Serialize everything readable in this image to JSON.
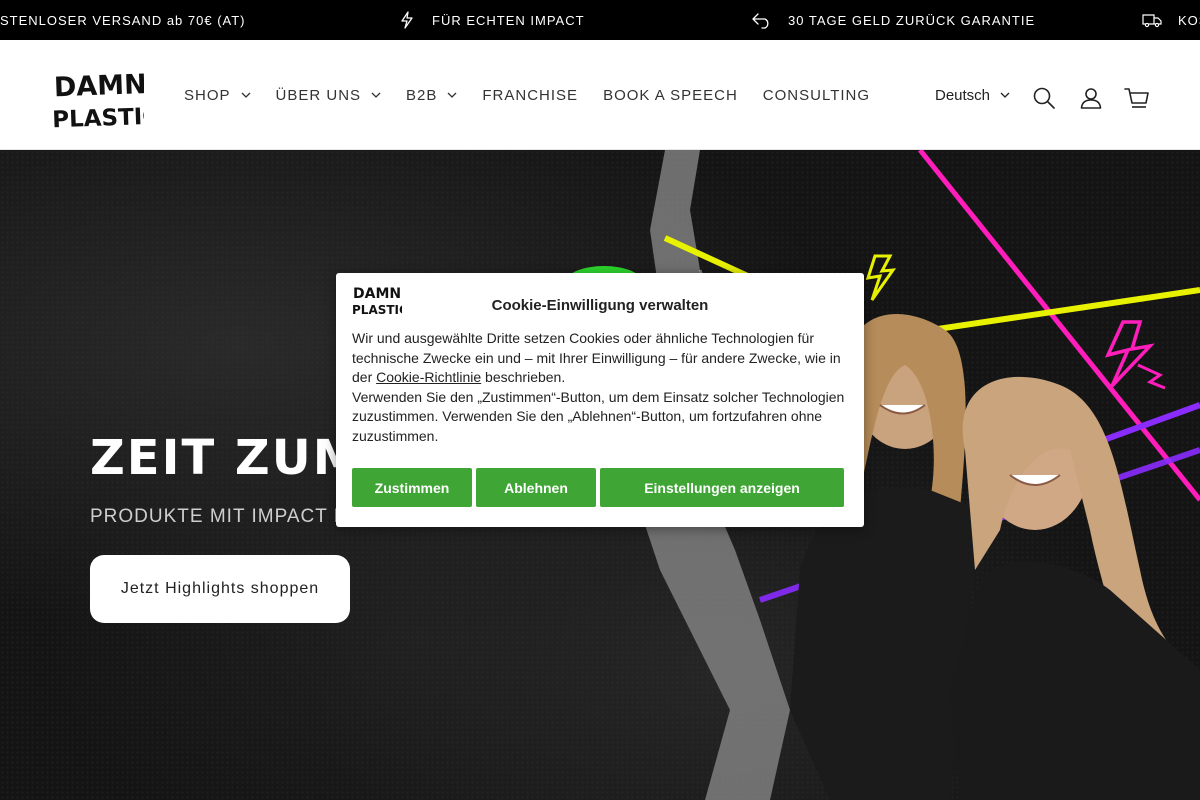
{
  "announcement_bar": {
    "items": [
      {
        "text": "STENLOSER VERSAND ab 70€ (AT)",
        "icon": "none"
      },
      {
        "text": "FÜR ECHTEN IMPACT",
        "icon": "lightning-icon"
      },
      {
        "text": "30 TAGE GELD ZURÜCK GARANTIE",
        "icon": "return-arrow-icon"
      },
      {
        "text": "KOS",
        "icon": "truck-icon"
      }
    ]
  },
  "header": {
    "logo_text": [
      "DAMN",
      "PLASTIC"
    ],
    "nav": [
      {
        "label": "SHOP",
        "has_dropdown": true
      },
      {
        "label": "ÜBER UNS",
        "has_dropdown": true
      },
      {
        "label": "B2B",
        "has_dropdown": true
      },
      {
        "label": "FRANCHISE",
        "has_dropdown": false
      },
      {
        "label": "BOOK A SPEECH",
        "has_dropdown": false
      },
      {
        "label": "CONSULTING",
        "has_dropdown": false
      }
    ],
    "language": "Deutsch",
    "icons": [
      "search-icon",
      "account-icon",
      "cart-icon"
    ]
  },
  "hero": {
    "title": "ZEIT ZUM AI",
    "subtitle": "PRODUKTE MIT IMPACT F",
    "button_label": "Jetzt Highlights shoppen"
  },
  "cookie_dialog": {
    "logo_text": [
      "DAMN",
      "PLASTIC"
    ],
    "title": "Cookie-Einwilligung verwalten",
    "body_part1": "Wir und ausgewählte Dritte setzen Cookies oder ähnliche Technologien für technische Zwecke ein und – mit Ihrer Einwilligung – für andere Zwecke, wie in der ",
    "policy_link": "Cookie-Richtlinie",
    "body_part2": " beschrieben.",
    "body_part3": "Verwenden Sie den „Zustimmen“-Button, um dem Einsatz solcher Technologien zuzustimmen. Verwenden Sie den „Ablehnen“-Button, um fortzufahren ohne zuzustimmen.",
    "buttons": {
      "accept": "Zustimmen",
      "decline": "Ablehnen",
      "settings": "Einstellungen anzeigen"
    },
    "accent": "#3fa535"
  },
  "colors": {
    "magenta": "#ff1dbb",
    "yellow": "#e8f200",
    "purple": "#8b2cff",
    "green": "#2dd62d"
  }
}
